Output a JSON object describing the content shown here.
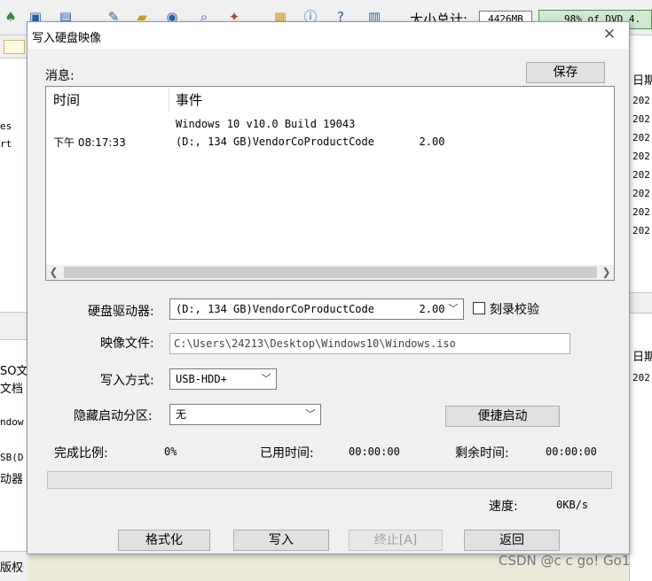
{
  "background": {
    "toolbar": {
      "total_label": "大小总计:",
      "total_size": "4426MB",
      "capacity_text": "98% of DVD 4."
    },
    "left_panel": {
      "texts": [
        "es",
        "rt",
        "SO文",
        "文档",
        "ndow",
        "SB(D",
        "动器",
        "版权"
      ]
    },
    "right_panel": {
      "header_top": "日期",
      "dates_top": [
        "202",
        "202",
        "202",
        "202",
        "202",
        "202",
        "202",
        "202"
      ],
      "header_bottom": "日期",
      "dates_bottom": [
        "202"
      ]
    },
    "watermark": "CSDN @c c go! Go1"
  },
  "dialog": {
    "title": "写入硬盘映像",
    "messages_label": "消息:",
    "save_button": "保存",
    "log": {
      "columns": [
        "时间",
        "事件"
      ],
      "rows": [
        {
          "time": "",
          "event": "Windows 10 v10.0 Build 19043"
        },
        {
          "time": "下午 08:17:33",
          "event": "(D:, 134 GB)VendorCoProductCode       2.00"
        }
      ]
    },
    "drive_label": "硬盘驱动器:",
    "drive_value": "(D:, 134 GB)VendorCoProductCode       2.00",
    "verify_label": "刻录校验",
    "image_label": "映像文件:",
    "image_path": "C:\\Users\\24213\\Desktop\\Windows10\\Windows.iso",
    "write_method_label": "写入方式:",
    "write_method_value": "USB-HDD+",
    "hidden_partition_label": "隐藏启动分区:",
    "hidden_partition_value": "无",
    "convenient_boot_button": "便捷启动",
    "progress_label": "完成比例:",
    "progress_value": "0%",
    "progress_fraction": 0,
    "elapsed_label": "已用时间:",
    "elapsed_value": "00:00:00",
    "remaining_label": "剩余时间:",
    "remaining_value": "00:00:00",
    "speed_label": "速度:",
    "speed_value": "0KB/s",
    "buttons": {
      "format": "格式化",
      "write": "写入",
      "stop": "终止[A]",
      "back": "返回"
    }
  }
}
